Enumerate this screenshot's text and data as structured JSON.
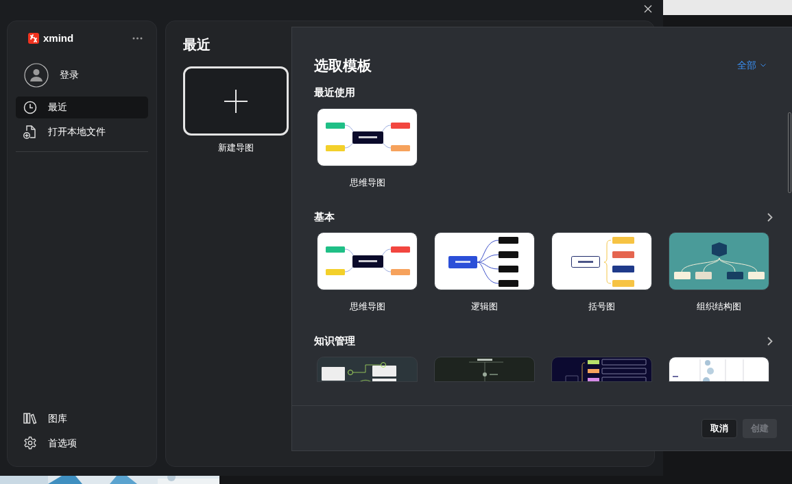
{
  "sidebar": {
    "logo_text": "xmind",
    "user": {
      "label": "登录"
    },
    "items": [
      {
        "label": "最近",
        "kind": "clock",
        "selected": true
      },
      {
        "label": "打开本地文件",
        "kind": "file-add",
        "selected": false
      }
    ],
    "bottom_items": [
      {
        "label": "图库",
        "kind": "library"
      },
      {
        "label": "首选项",
        "kind": "gear"
      }
    ]
  },
  "main": {
    "title": "最近",
    "new_map": {
      "label": "新建导图"
    }
  },
  "template_dialog": {
    "title": "选取模板",
    "filter": "全部",
    "sections": [
      {
        "title": "最近使用",
        "more": false,
        "templates": [
          {
            "kind": "mindmap",
            "label": "思维导图"
          }
        ]
      },
      {
        "title": "基本",
        "more": true,
        "templates": [
          {
            "kind": "mindmap",
            "label": "思维导图"
          },
          {
            "kind": "logic",
            "label": "逻辑图"
          },
          {
            "kind": "brace",
            "label": "括号图"
          },
          {
            "kind": "org",
            "label": "组织结构图"
          }
        ]
      },
      {
        "title": "知识管理",
        "more": true,
        "templates": [
          {
            "kind": "dark-notes"
          },
          {
            "kind": "dark-timeline"
          },
          {
            "kind": "navy-list"
          },
          {
            "kind": "white-diagram"
          }
        ]
      }
    ],
    "buttons": [
      {
        "label": "取消",
        "disabled": false
      },
      {
        "label": "创建",
        "disabled": true
      }
    ]
  }
}
